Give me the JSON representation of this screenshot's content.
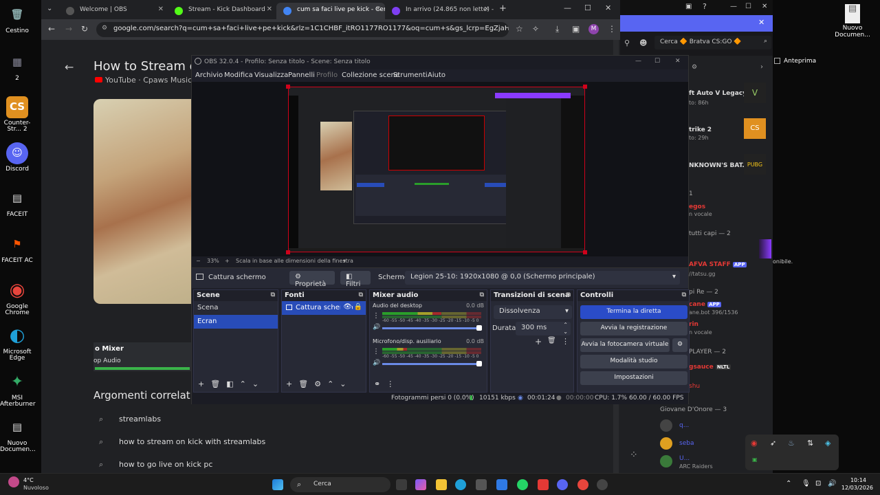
{
  "desktop": {
    "left_icons": [
      {
        "label": "Cestino",
        "glyph": "🗑",
        "color": "#8aa"
      },
      {
        "label": "2",
        "glyph": "▦",
        "color": "#667"
      },
      {
        "label": "Counter-Str... 2",
        "glyph": "CS",
        "color": "#e09020"
      },
      {
        "label": "Discord",
        "glyph": "☺",
        "color": "#5865f2"
      },
      {
        "label": "FACEIT",
        "glyph": "▤",
        "color": "#ddd"
      },
      {
        "label": "FACEIT AC",
        "glyph": "⚑",
        "color": "#ff5500"
      },
      {
        "label": "Google Chrome",
        "glyph": "◉",
        "color": "#e8453c"
      },
      {
        "label": "Microsoft Edge",
        "glyph": "◐",
        "color": "#1fa0d8"
      },
      {
        "label": "MSI Afterburner",
        "glyph": "✦",
        "color": "#3a6"
      },
      {
        "label": "Nuovo Documen...",
        "glyph": "▤",
        "color": "#ddd"
      }
    ],
    "right_icons": [
      {
        "label": "Nuovo Documen...",
        "glyph": "▤"
      }
    ]
  },
  "chrome": {
    "tabs": [
      {
        "title": "Welcome | OBS",
        "fav_color": "#555"
      },
      {
        "title": "Stream - Kick Dashboard",
        "fav_color": "#53fc18"
      },
      {
        "title": "cum sa faci live pe kick - Cerca c",
        "fav_color": "#4285f4"
      },
      {
        "title": "In arrivo (24.865 non lette) - jg...",
        "fav_color": "#7e3ff2"
      }
    ],
    "url": "google.com/search?q=cum+sa+faci+live+pe+kick&rlz=1C1CHBF_itRO1177RO1177&oq=cum+s&gs_lcrp=EgZjaHJvbWUqBggAEE...",
    "avatar": "M",
    "video_title": "How to Stream on",
    "channel": "YouTube · Cpaws Music · 2",
    "mixer_title": "o Mixer",
    "mixer_sub": "op Audio",
    "related_heading": "Argomenti correlati",
    "related": [
      "streamlabs",
      "how to stream on kick with streamlabs",
      "how to go live on kick pc"
    ]
  },
  "obs": {
    "title": "OBS 32.0.4 - Profilo: Senza titolo - Scene: Senza titolo",
    "menu": [
      "Archivio",
      "Modifica",
      "Visualizza",
      "Pannelli",
      "Profilo",
      "Collezione scene",
      "Strumenti",
      "Aiuto"
    ],
    "zoom": "33%",
    "scale_mode": "Scala in base alle dimensioni della finestra",
    "source_name": "Cattura schermo",
    "properties_label": "Proprietà",
    "filters_label": "Filtri",
    "screen_label": "Schermo",
    "screen_value": "Legion 25-10: 1920x1080 @ 0,0 (Schermo principale)",
    "docks": {
      "scenes": {
        "title": "Scene",
        "items": [
          "Scena",
          "Ecran"
        ],
        "selected": 1
      },
      "sources": {
        "title": "Fonti",
        "items": [
          "Cattura schermo"
        ]
      },
      "mixer": {
        "title": "Mixer audio",
        "channels": [
          {
            "name": "Audio del desktop",
            "db": "0.0 dB",
            "level": 0.6
          },
          {
            "name": "Microfono/disp. ausiliario",
            "db": "0.0 dB",
            "level": 0.25
          }
        ],
        "scale": "-60 -55 -50 -45 -40 -35 -30 -25 -20 -15 -10 -5 0"
      },
      "transitions": {
        "title": "Transizioni di scena",
        "type": "Dissolvenza",
        "duration_label": "Durata",
        "duration": "300 ms"
      },
      "controls": {
        "title": "Controlli",
        "buttons": [
          "Termina la diretta",
          "Avvia la registrazione",
          "Avvia la fotocamera virtuale",
          "Modalità studio",
          "Impostazioni"
        ]
      }
    },
    "status": {
      "dropped": "Fotogrammi persi 0 (0.0%)",
      "bitrate": "10151 kbps",
      "live_time": "00:01:24",
      "rec_time": "00:00:00",
      "cpu": "CPU: 1.7%",
      "fps": "60.00 / 60.00 FPS"
    },
    "colors": {
      "accent": "#284cb8",
      "stream_button": "#2a4cc8",
      "canvas_border": "#d0021b"
    }
  },
  "right_window": {
    "search_placeholder": "Cerca 🔶 Bratva CS:GO 🔶",
    "preview_label": "Anteprima",
    "games": [
      {
        "name": "ft Auto V Legacy",
        "sub": "to: 86h"
      },
      {
        "name": "trike 2",
        "sub": "to: 29h"
      },
      {
        "name": "NKNOWN'S BAT...",
        "sub": ""
      }
    ],
    "chat_lines": [
      "1",
      "egos",
      "n vocale",
      "tutti capi — 2",
      "AFVA STAFF",
      "//tatsu.gg",
      "pi Re — 2",
      "cane",
      "ane.bot 396/1536",
      "rin",
      "n vocale",
      "PLAYER — 2",
      "gsauce",
      "shu",
      "Giovane D'Onore — 3",
      "q...",
      "seba",
      "U...",
      "ARC Raiders"
    ],
    "badges": {
      "app": "APP",
      "nltl": "NLTL"
    },
    "side_text": "onibile."
  },
  "taskbar": {
    "weather_temp": "4°C",
    "weather_desc": "Nuvoloso",
    "search_label": "Cerca",
    "time": "10:14",
    "date": "12/03/2026"
  }
}
